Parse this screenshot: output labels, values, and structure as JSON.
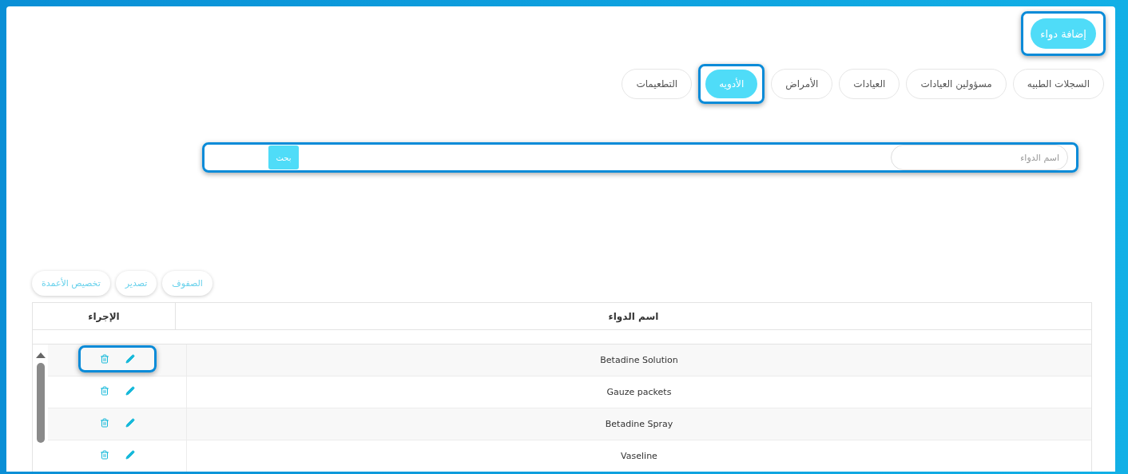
{
  "add_button": {
    "label": "إضافة دواء",
    "highlighted": true
  },
  "tabs": [
    {
      "label": "السجلات الطبيه",
      "selected": false
    },
    {
      "label": "مسؤولين العيادات",
      "selected": false
    },
    {
      "label": "العيادات",
      "selected": false
    },
    {
      "label": "الأمراض",
      "selected": false
    },
    {
      "label": "الأدويه",
      "selected": true
    },
    {
      "label": "التطعيمات",
      "selected": false
    }
  ],
  "search": {
    "placeholder": "اسم الدواء",
    "button": "بحث",
    "highlighted": true
  },
  "toolbar": [
    "الصفوف",
    "تصدير",
    "تخصيص الأعمدة"
  ],
  "table": {
    "columns": [
      "اسم الدواء",
      "الإجراء"
    ],
    "rows": [
      {
        "name": "Betadine Solution",
        "highlighted": true
      },
      {
        "name": "Gauze packets",
        "highlighted": false
      },
      {
        "name": "Betadine Spray",
        "highlighted": false
      },
      {
        "name": "Vaseline",
        "highlighted": false
      }
    ]
  }
}
